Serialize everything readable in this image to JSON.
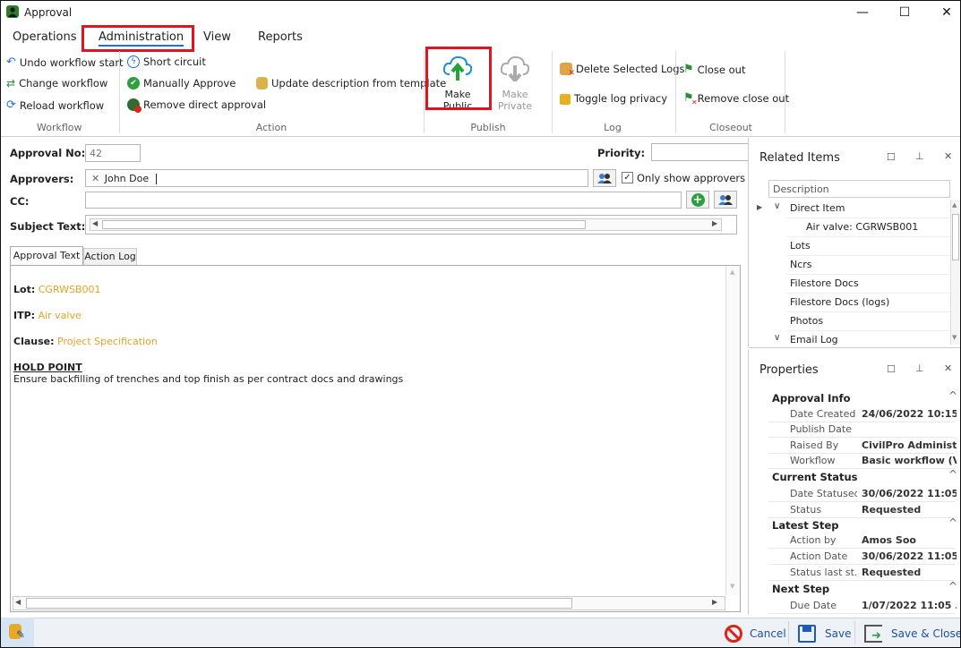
{
  "window": {
    "title": "Approval",
    "minimize": "—",
    "maximize": "☐",
    "close": "✕"
  },
  "menu": {
    "tabs": [
      "Operations",
      "Administration",
      "View",
      "Reports"
    ]
  },
  "ribbon": {
    "workflow": {
      "items": [
        "Undo workflow start",
        "Change workflow",
        "Reload workflow"
      ],
      "group": "Workflow"
    },
    "action": {
      "items": [
        "Short circuit",
        "Manually Approve",
        "Remove direct approval",
        "Update description from template"
      ],
      "group": "Action"
    },
    "publish": {
      "make_public": "Make Public",
      "make_private": "Make Private",
      "group": "Publish"
    },
    "log": {
      "items": [
        "Delete Selected Logs",
        "Toggle log privacy"
      ],
      "group": "Log"
    },
    "closeout": {
      "items": [
        "Close out",
        "Remove close out"
      ],
      "group": "Closeout"
    }
  },
  "form": {
    "approval_no_label": "Approval No:",
    "approval_no": "42",
    "priority_label": "Priority:",
    "approvers_label": "Approvers:",
    "approver_token": "John  Doe",
    "only_show_approvers": "Only show approvers",
    "only_show_approvers_checked": true,
    "cc_label": "CC:",
    "subject_label": "Subject Text:"
  },
  "tabs": {
    "approval_text": "Approval Text",
    "action_log": "Action Log"
  },
  "approval_text": {
    "lot_label": "Lot:",
    "lot_value": "CGRWSB001",
    "itp_label": "ITP:",
    "itp_value": "Air valve",
    "clause_label": "Clause:",
    "clause_value": "Project Specification",
    "hold_point": "HOLD POINT",
    "body": "Ensure backfilling of trenches and top finish as per contract docs and drawings"
  },
  "related_items": {
    "title": "Related Items",
    "column": "Description",
    "rows": [
      "Direct Item",
      "Air valve: CGRWSB001",
      "Lots",
      "Ncrs",
      "Filestore Docs",
      "Filestore Docs (logs)",
      "Photos",
      "Email Log"
    ]
  },
  "properties": {
    "title": "Properties",
    "sections": [
      {
        "name": "Approval Info",
        "rows": [
          [
            "Date Created",
            "24/06/2022 10:15..."
          ],
          [
            "Publish Date",
            ""
          ],
          [
            "Raised By",
            "CivilPro Administr..."
          ],
          [
            "Workflow",
            "Basic workflow (V2)"
          ]
        ]
      },
      {
        "name": "Current Status",
        "rows": [
          [
            "Date Statused",
            "30/06/2022 11:05..."
          ],
          [
            "Status",
            "Requested"
          ]
        ]
      },
      {
        "name": "Latest Step",
        "rows": [
          [
            "Action by",
            "Amos Soo"
          ],
          [
            "Action Date",
            "30/06/2022 11:05..."
          ],
          [
            "Status last st...",
            "Requested"
          ]
        ]
      },
      {
        "name": "Next Step",
        "rows": [
          [
            "Due Date",
            "1/07/2022 11:05 ..."
          ]
        ]
      }
    ]
  },
  "footer": {
    "cancel": "Cancel",
    "save": "Save",
    "save_close": "Save & Close"
  },
  "colors": {
    "accent": "#1e6fd9",
    "highlight": "#e0141e",
    "orange_text": "#e6a126"
  }
}
